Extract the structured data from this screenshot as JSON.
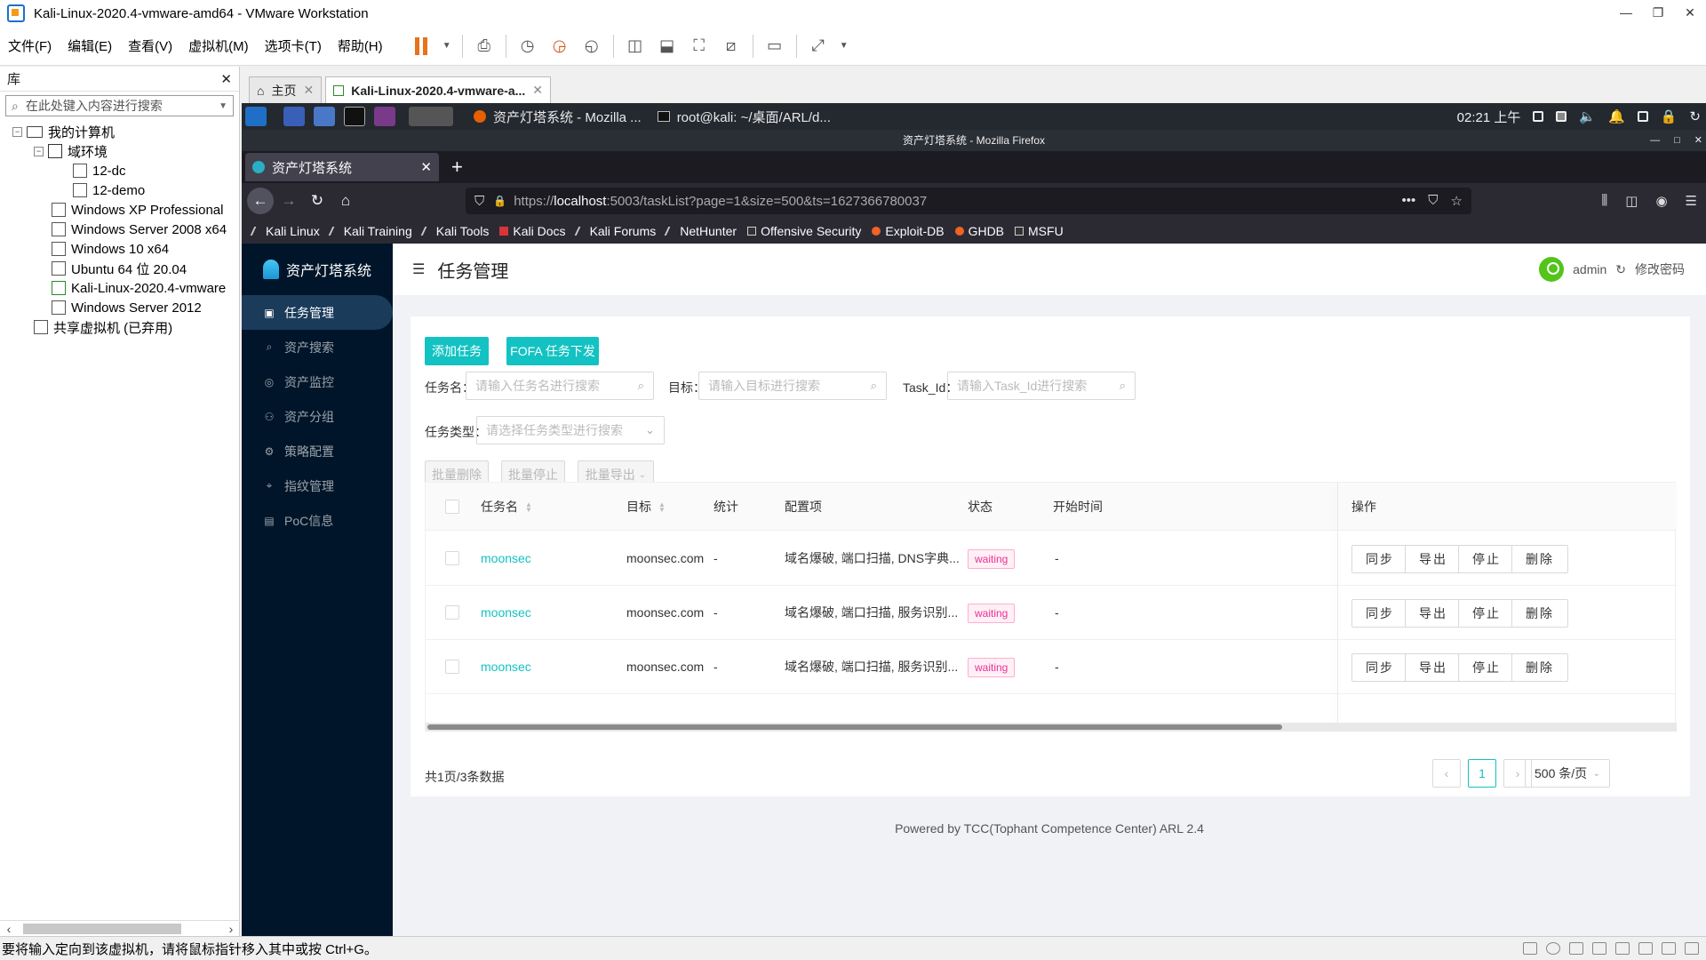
{
  "vmware": {
    "title": "Kali-Linux-2020.4-vmware-amd64 - VMware Workstation",
    "menu": [
      "文件(F)",
      "编辑(E)",
      "查看(V)",
      "虚拟机(M)",
      "选项卡(T)",
      "帮助(H)"
    ],
    "library": {
      "title": "库",
      "search_placeholder": "在此处键入内容进行搜索",
      "tree": [
        {
          "label": "我的计算机",
          "level": 0
        },
        {
          "label": "域环境",
          "level": 1
        },
        {
          "label": "12-dc",
          "level": 2
        },
        {
          "label": "12-demo",
          "level": 2
        },
        {
          "label": "Windows XP Professional",
          "level": 1
        },
        {
          "label": "Windows Server 2008 x64",
          "level": 1
        },
        {
          "label": "Windows 10 x64",
          "level": 1
        },
        {
          "label": "Ubuntu 64 位 20.04",
          "level": 1
        },
        {
          "label": "Kali-Linux-2020.4-vmware",
          "level": 1
        },
        {
          "label": "Windows Server 2012",
          "level": 1
        },
        {
          "label": "共享虚拟机 (已弃用)",
          "level": 0
        }
      ]
    },
    "tabs": [
      {
        "label": "主页",
        "active": false
      },
      {
        "label": "Kali-Linux-2020.4-vmware-a...",
        "active": true
      }
    ],
    "status_text": "要将输入定向到该虚拟机，请将鼠标指针移入其中或按 Ctrl+G。"
  },
  "kali_panel": {
    "tasks": [
      {
        "label": "资产灯塔系统 - Mozilla ...",
        "icon": "firefox-icon"
      },
      {
        "label": "root@kali: ~/桌面/ARL/d...",
        "icon": "terminal-icon"
      }
    ],
    "clock": "02:21 上午"
  },
  "firefox": {
    "window_title": "资产灯塔系统 - Mozilla Firefox",
    "tab_title": "资产灯塔系统",
    "url_prefix": "https://",
    "url_host": "localhost",
    "url_rest": ":5003/taskList?page=1&size=500&ts=1627366780037",
    "bookmarks": [
      {
        "label": "Kali Linux",
        "icon": "kali-icon"
      },
      {
        "label": "Kali Training",
        "icon": "kali-icon"
      },
      {
        "label": "Kali Tools",
        "icon": "kali-icon"
      },
      {
        "label": "Kali Docs",
        "icon": "docs-icon"
      },
      {
        "label": "Kali Forums",
        "icon": "kali-icon"
      },
      {
        "label": "NetHunter",
        "icon": "kali-icon"
      },
      {
        "label": "Offensive Security",
        "icon": "offsec-icon"
      },
      {
        "label": "Exploit-DB",
        "icon": "exploitdb-icon"
      },
      {
        "label": "GHDB",
        "icon": "exploitdb-icon"
      },
      {
        "label": "MSFU",
        "icon": "offsec-icon"
      }
    ]
  },
  "arl": {
    "brand": "资产灯塔系统",
    "nav": [
      {
        "label": "任务管理",
        "icon": "task-icon",
        "active": true
      },
      {
        "label": "资产搜索",
        "icon": "search-icon",
        "active": false
      },
      {
        "label": "资产监控",
        "icon": "monitor-icon",
        "active": false
      },
      {
        "label": "资产分组",
        "icon": "group-icon",
        "active": false
      },
      {
        "label": "策略配置",
        "icon": "policy-icon",
        "active": false
      },
      {
        "label": "指纹管理",
        "icon": "fingerprint-icon",
        "active": false
      },
      {
        "label": "PoC信息",
        "icon": "poc-icon",
        "active": false
      }
    ],
    "page_title": "任务管理",
    "user": "admin",
    "change_password": "修改密码",
    "buttons": {
      "add_task": "添加任务",
      "fofa_task": "FOFA 任务下发",
      "batch_delete": "批量删除",
      "batch_stop": "批量停止",
      "batch_export": "批量导出"
    },
    "filters": {
      "task_name_label": "任务名：",
      "task_name_placeholder": "请输入任务名进行搜索",
      "target_label": "目标：",
      "target_placeholder": "请输入目标进行搜索",
      "task_id_label": "Task_Id：",
      "task_id_placeholder": "请输入Task_Id进行搜索",
      "task_type_label": "任务类型：",
      "task_type_placeholder": "请选择任务类型进行搜索"
    },
    "columns": [
      "任务名",
      "目标",
      "统计",
      "配置项",
      "状态",
      "开始时间",
      "操作"
    ],
    "rows": [
      {
        "name": "moonsec",
        "target": "moonsec.com",
        "stats": "-",
        "config": "域名爆破, 端口扫描, DNS字典...",
        "status": "waiting",
        "start": "-"
      },
      {
        "name": "moonsec",
        "target": "moonsec.com",
        "stats": "-",
        "config": "域名爆破, 端口扫描, 服务识别...",
        "status": "waiting",
        "start": "-"
      },
      {
        "name": "moonsec",
        "target": "moonsec.com",
        "stats": "-",
        "config": "域名爆破, 端口扫描, 服务识别...",
        "status": "waiting",
        "start": "-"
      }
    ],
    "row_actions": [
      "同步",
      "导出",
      "停止",
      "删除"
    ],
    "total_text": "共1页/3条数据",
    "pagination": {
      "current": "1",
      "page_size": "500 条/页"
    },
    "footer": "Powered by TCC(Tophant Competence Center) ARL 2.4"
  }
}
